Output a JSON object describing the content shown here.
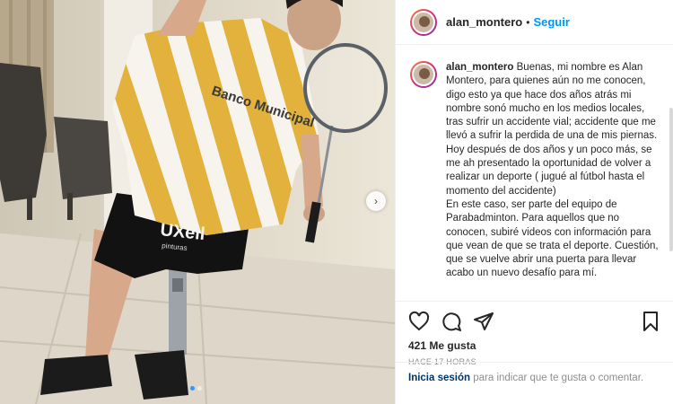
{
  "post": {
    "username": "alan_montero",
    "separator": "•",
    "follow_label": "Seguir",
    "caption_username": "alan_montero",
    "caption_text": "Buenas, mi nombre es Alan Montero, para quienes aún no me conocen, digo esto ya que hace dos años atrás mi nombre sonó mucho en los medios locales, tras sufrir un accidente vial; accidente que me llevó a sufrir  la perdida de  una de mis piernas.\nHoy después de dos años y un poco más, se me ah presentado la oportunidad de volver a realizar un deporte ( jugué al fútbol hasta el momento del accidente)\nEn este caso, ser parte del equipo de Parabadminton. Para aquellos que no conocen, subiré videos con información para que vean de que se trata el deporte. Cuestión, que se vuelve abrir una puerta para llevar acabo un nuevo desafío para mí.",
    "likes": "421 Me gusta",
    "time": "HACE 17 HORAS",
    "login_link": "Inicia sesión",
    "login_text": " para indicar que te gusta o comentar."
  },
  "photo": {
    "shirt_text": "Banco Municipal",
    "shorts_text": "UXell",
    "shorts_subtext": "pinturas"
  },
  "icons": {
    "like": "heart-icon",
    "comment": "comment-icon",
    "share": "share-icon",
    "save": "bookmark-icon",
    "next": "chevron-right-icon"
  },
  "colors": {
    "follow": "#0095f6",
    "link": "#003569",
    "muted": "#8e8e8e",
    "jersey_gold": "#e3b23c"
  }
}
